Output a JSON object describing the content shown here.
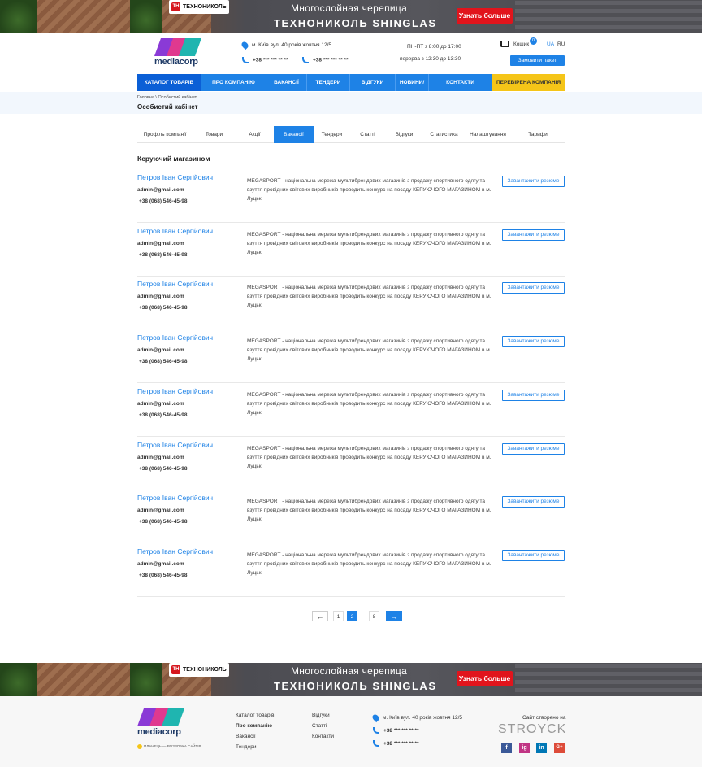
{
  "banners": {
    "brand": "ТЕХНОНИКОЛЬ",
    "line1": "Многослойная черепица",
    "line2": "ТЕХНОНИКОЛЬ SHINGLAS",
    "cta": "Узнать больше"
  },
  "header": {
    "logo": "mediacorp",
    "address": "м. Київ вул. 40 років жовтня 12/5",
    "phone1": "+38 *** *** ** **",
    "phone2": "+38 *** *** ** **",
    "hours": "ПН-ПТ з 8:00 до 17:00",
    "break": "перерва з 12:30 до 13:30",
    "cart_label": "Кошик",
    "cart_count": "0",
    "lang_ua": "UA",
    "lang_ru": "RU",
    "order_button": "Замовити пакет"
  },
  "nav": [
    "КАТАЛОГ ТОВАРІВ",
    "ПРО КОМПАНІЮ",
    "ВАКАНСІЇ",
    "ТЕНДЕРИ",
    "ВІДГУКИ",
    "НОВИНИ/АКЦІЇ",
    "КОНТАКТИ",
    "ПЕРЕВІРЕНА КОМПАНІЯ"
  ],
  "breadcrumb": "Головна \\ Особистий кабінет",
  "page_title": "Особистий кабінет",
  "tabs": [
    "Профіль компанії",
    "Товари",
    "Акції",
    "Вакансії",
    "Тендери",
    "Статті",
    "Відгуки",
    "Статистика",
    "Налаштування",
    "Тарифи"
  ],
  "active_tab": "Вакансії",
  "section_title": "Керуючий магазином",
  "vacancies": [
    {
      "name": "Петров Іван Сергійович",
      "email": "admin@gmail.com",
      "phone": "+38 (068) 546-45-98",
      "desc": "MEGASPORT - національна мережа мультибрендових магазинів з продажу спортивного одягу та взуття провідних світових виробників проводить конкурс на посаду КЕРУЮЧОГО МАГАЗИНОМ в м. Луцьк!",
      "button": "Завантажити резюме"
    },
    {
      "name": "Петров Іван Сергійович",
      "email": "admin@gmail.com",
      "phone": "+38 (068) 546-45-98",
      "desc": "MEGASPORT - національна мережа мультибрендових магазинів з продажу спортивного одягу та взуття провідних світових виробників проводить конкурс на посаду КЕРУЮЧОГО МАГАЗИНОМ в м. Луцьк!",
      "button": "Завантажити резюме"
    },
    {
      "name": "Петров Іван Сергійович",
      "email": "admin@gmail.com",
      "phone": "+38 (068) 546-45-98",
      "desc": "MEGASPORT - національна мережа мультибрендових магазинів з продажу спортивного одягу та взуття провідних світових виробників проводить конкурс на посаду КЕРУЮЧОГО МАГАЗИНОМ в м. Луцьк!",
      "button": "Завантажити резюме"
    },
    {
      "name": "Петров Іван Сергійович",
      "email": "admin@gmail.com",
      "phone": "+38 (068) 546-45-98",
      "desc": "MEGASPORT - національна мережа мультибрендових магазинів з продажу спортивного одягу та взуття провідних світових виробників проводить конкурс на посаду КЕРУЮЧОГО МАГАЗИНОМ в м. Луцьк!",
      "button": "Завантажити резюме"
    },
    {
      "name": "Петров Іван Сергійович",
      "email": "admin@gmail.com",
      "phone": "+38 (068) 546-45-98",
      "desc": "MEGASPORT - національна мережа мультибрендових магазинів з продажу спортивного одягу та взуття провідних світових виробників проводить конкурс на посаду КЕРУЮЧОГО МАГАЗИНОМ в м. Луцьк!",
      "button": "Завантажити резюме"
    },
    {
      "name": "Петров Іван Сергійович",
      "email": "admin@gmail.com",
      "phone": "+38 (068) 546-45-98",
      "desc": "MEGASPORT - національна мережа мультибрендових магазинів з продажу спортивного одягу та взуття провідних світових виробників проводить конкурс на посаду КЕРУЮЧОГО МАГАЗИНОМ в м. Луцьк!",
      "button": "Завантажити резюме"
    },
    {
      "name": "Петров Іван Сергійович",
      "email": "admin@gmail.com",
      "phone": "+38 (068) 546-45-98",
      "desc": "MEGASPORT - національна мережа мультибрендових магазинів з продажу спортивного одягу та взуття провідних світових виробників проводить конкурс на посаду КЕРУЮЧОГО МАГАЗИНОМ в м. Луцьк!",
      "button": "Завантажити резюме"
    },
    {
      "name": "Петров Іван Сергійович",
      "email": "admin@gmail.com",
      "phone": "+38 (068) 546-45-98",
      "desc": "MEGASPORT - національна мережа мультибрендових магазинів з продажу спортивного одягу та взуття провідних світових виробників проводить конкурс на посаду КЕРУЮЧОГО МАГАЗИНОМ в м. Луцьк!",
      "button": "Завантажити резюме"
    }
  ],
  "pagination": {
    "prev": "←",
    "p1": "1",
    "current": "2",
    "dots": "...",
    "last": "8",
    "next": "→"
  },
  "footer": {
    "logo": "mediacorp",
    "tagline": "ПЛАНЕЦЬ — РОЗРОБКА САЙТІВ",
    "links1": [
      "Каталог товарів",
      "Про компанію",
      "Вакансії",
      "Тендери"
    ],
    "links2": [
      "Відгуки",
      "Статті",
      "Контакти"
    ],
    "address": "м. Київ вул. 40 років жовтня 12/5",
    "phone1": "+38 *** *** ** **",
    "phone2": "+38 *** *** ** **",
    "created": "Сайт створено на",
    "studio": "STROYCK",
    "social": [
      "f",
      "ig",
      "in",
      "G+"
    ]
  }
}
